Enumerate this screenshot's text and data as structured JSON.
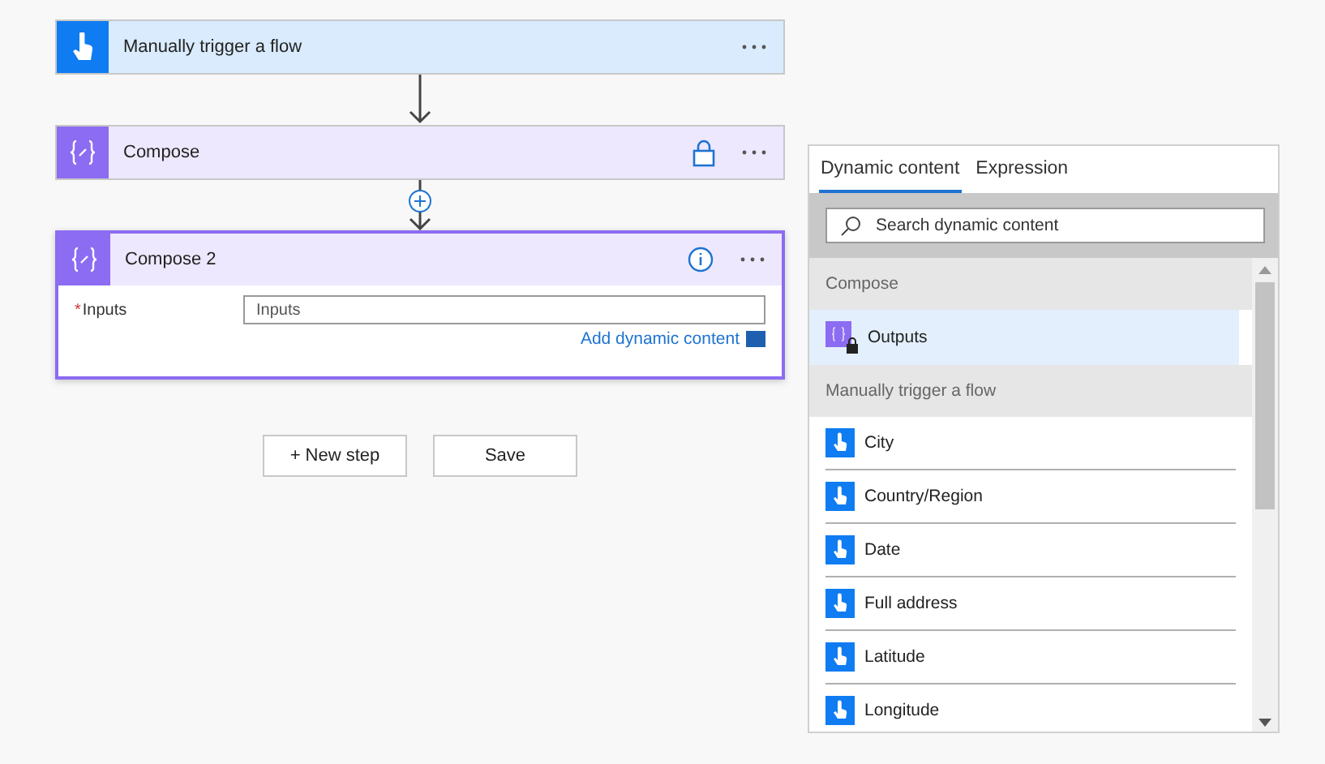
{
  "steps": [
    {
      "kind": "trigger",
      "title": "Manually trigger a flow",
      "locked": false,
      "info_button": false,
      "expanded": false
    },
    {
      "kind": "compose",
      "title": "Compose",
      "locked": true,
      "info_button": false,
      "expanded": false
    },
    {
      "kind": "compose",
      "title": "Compose 2",
      "locked": false,
      "info_button": true,
      "expanded": true,
      "field": {
        "label": "Inputs",
        "required_mark": "*",
        "placeholder": "Inputs",
        "link": "Add dynamic content"
      }
    }
  ],
  "connectors": [
    {
      "kind": "arrow"
    },
    {
      "kind": "plus"
    }
  ],
  "buttons": [
    "+ New step",
    "Save"
  ],
  "panel": {
    "tabs": [
      {
        "label": "Dynamic content",
        "selected": true
      },
      {
        "label": "Expression",
        "selected": false
      }
    ],
    "search": {
      "placeholder": "Search dynamic content"
    },
    "sections": [
      {
        "header": "Compose",
        "items": [
          {
            "kind": "compose",
            "label": "Outputs",
            "selected": true
          }
        ]
      },
      {
        "header": "Manually trigger a flow",
        "items": [
          {
            "kind": "trigger",
            "label": "City",
            "selected": false
          },
          {
            "kind": "trigger",
            "label": "Country/Region",
            "selected": false
          },
          {
            "kind": "trigger",
            "label": "Date",
            "selected": false
          },
          {
            "kind": "trigger",
            "label": "Full address",
            "selected": false
          },
          {
            "kind": "trigger",
            "label": "Latitude",
            "selected": false
          },
          {
            "kind": "trigger",
            "label": "Longitude",
            "selected": false
          }
        ]
      }
    ]
  }
}
